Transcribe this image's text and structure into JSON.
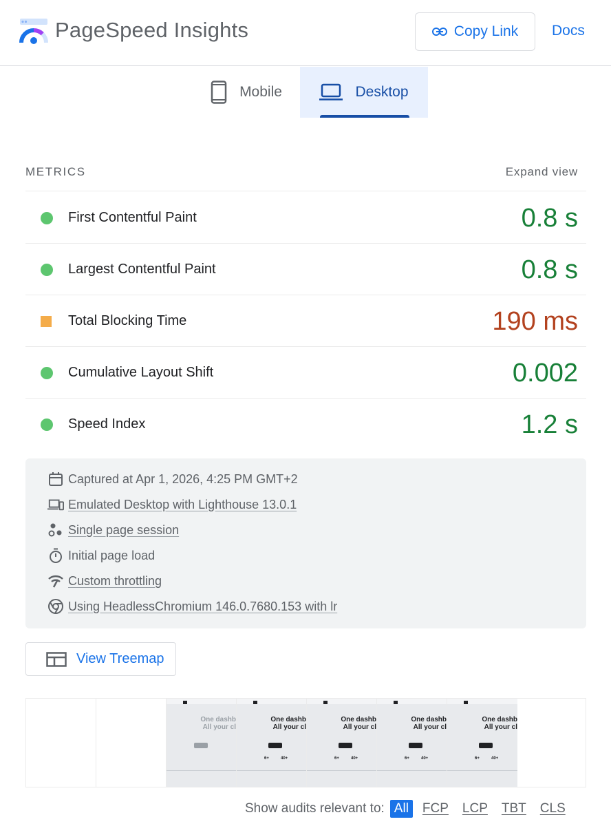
{
  "header": {
    "title": "PageSpeed Insights",
    "copy_link_label": "Copy Link",
    "docs_label": "Docs"
  },
  "tabs": [
    {
      "label": "Mobile",
      "selected": false
    },
    {
      "label": "Desktop",
      "selected": true
    }
  ],
  "metrics": {
    "title": "METRICS",
    "expand_label": "Expand view",
    "items": [
      {
        "label": "First Contentful Paint",
        "value": "0.8 s",
        "status": "good"
      },
      {
        "label": "Largest Contentful Paint",
        "value": "0.8 s",
        "status": "good"
      },
      {
        "label": "Total Blocking Time",
        "value": "190 ms",
        "status": "average"
      },
      {
        "label": "Cumulative Layout Shift",
        "value": "0.002",
        "status": "good"
      },
      {
        "label": "Speed Index",
        "value": "1.2 s",
        "status": "good"
      }
    ]
  },
  "info": {
    "captured": "Captured at Apr 1, 2026, 4:25 PM GMT+2",
    "emulated": "Emulated Desktop with Lighthouse 13.0.1",
    "session": "Single page session",
    "load": "Initial page load",
    "throttling": "Custom throttling",
    "browser": "Using HeadlessChromium 146.0.7680.153 with lr"
  },
  "treemap_label": "View Treemap",
  "filmstrip": {
    "headline_1": "One dashb",
    "headline_2": "All your cl",
    "stat_a": "6+",
    "stat_b": "40+"
  },
  "audits": {
    "label": "Show audits relevant to:",
    "filters": [
      "All",
      "FCP",
      "LCP",
      "TBT",
      "CLS"
    ]
  },
  "colors": {
    "accent": "#1a73e8",
    "good": "#188038",
    "average": "#b3421f",
    "good_indicator": "#5dc66f",
    "average_indicator": "#f4ac4a"
  }
}
